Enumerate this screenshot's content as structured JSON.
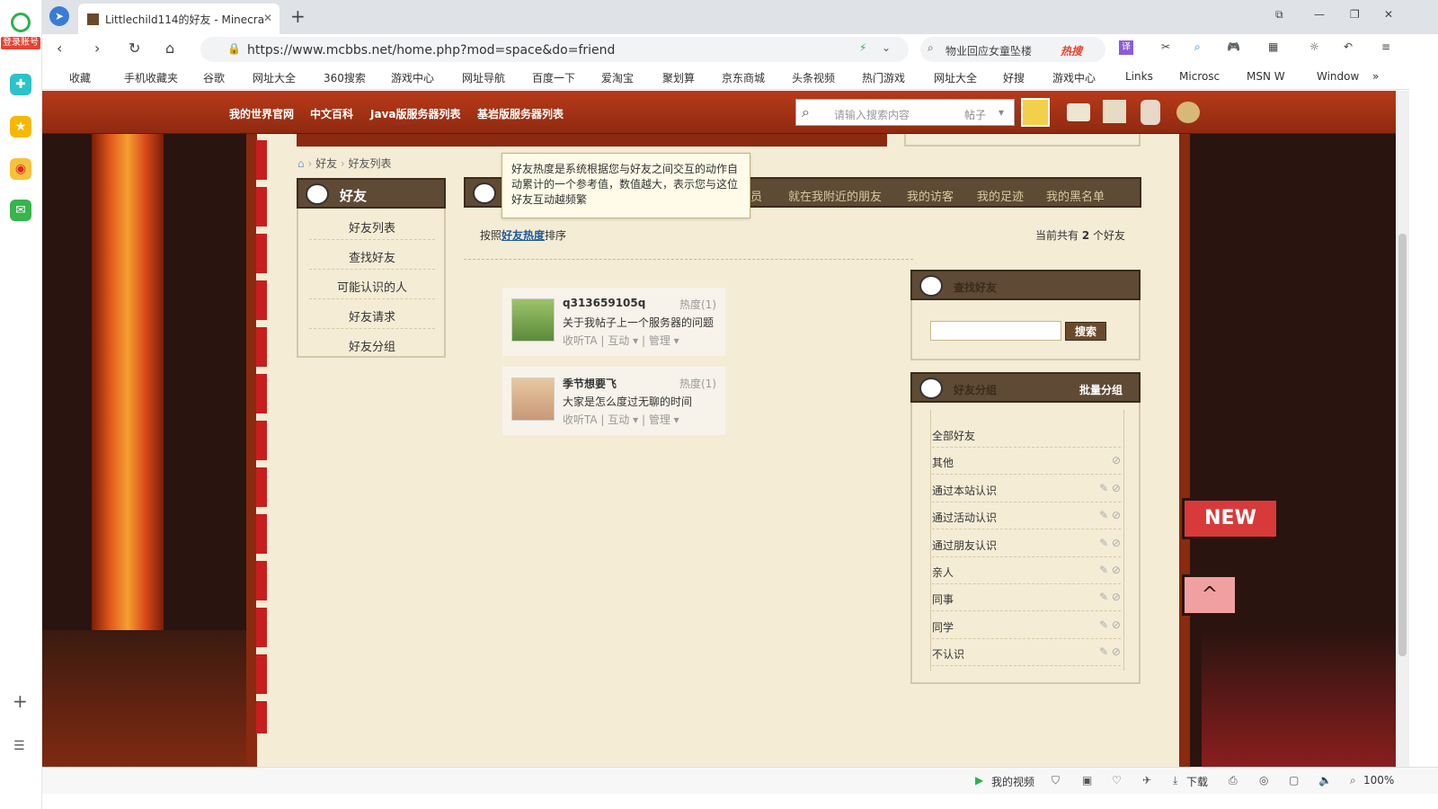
{
  "browser": {
    "tab_title": "Littlechild114的好友 - Minecra",
    "new_tab": "+",
    "url": "https://www.mcbbs.net/home.php?mod=space&do=friend",
    "search_hint": "物业回应女童坠楼",
    "hot_search": "热搜",
    "login_label": "登录账号",
    "window_buttons": {
      "min": "—",
      "max": "❐",
      "close": "✕"
    }
  },
  "bookmarks": [
    "收藏",
    "手机收藏夹",
    "谷歌",
    "网址大全",
    "360搜索",
    "游戏中心",
    "网址导航",
    "百度一下",
    "爱淘宝",
    "聚划算",
    "京东商城",
    "头条视频",
    "热门游戏",
    "网址大全",
    "好搜",
    "游戏中心",
    "Links",
    "Microsc",
    "MSN W",
    "Window",
    "»"
  ],
  "site": {
    "nav": [
      "我的世界官网",
      "中文百科",
      "Java版服务器列表",
      "基岩版服务器列表"
    ],
    "search_placeholder": "请输入搜索内容",
    "search_type": "帖子"
  },
  "breadcrumb": [
    "好友",
    "好友列表"
  ],
  "sidebar": {
    "title": "好友",
    "items": [
      "好友列表",
      "查找好友",
      "可能认识的人",
      "好友请求",
      "好友分组"
    ]
  },
  "tabs": [
    "员",
    "就在我附近的朋友",
    "我的访客",
    "我的足迹",
    "我的黑名单"
  ],
  "tooltip": "好友热度是系统根据您与好友之间交互的动作自动累计的一个参考值，数值越大，表示您与这位好友互动越频繁",
  "sort": {
    "prefix": "按照",
    "key": "好友热度",
    "suffix": "排序"
  },
  "count": {
    "prefix": "当前共有",
    "num": "2",
    "suffix": "个好友"
  },
  "friends": [
    {
      "name": "q313659105q",
      "heat": "热度(1)",
      "note": "关于我帖子上一个服务器的问题",
      "follow": "收听TA",
      "interact": "互动",
      "manage": "管理"
    },
    {
      "name": "季节想要飞",
      "heat": "热度(1)",
      "note": "大家是怎么度过无聊的时间",
      "follow": "收听TA",
      "interact": "互动",
      "manage": "管理"
    }
  ],
  "find_panel": {
    "title": "查找好友",
    "button": "搜索"
  },
  "groups_panel": {
    "title": "好友分组",
    "batch": "批量分组",
    "groups": [
      "全部好友",
      "其他",
      "通过本站认识",
      "通过活动认识",
      "通过朋友认识",
      "亲人",
      "同事",
      "同学",
      "不认识"
    ]
  },
  "statusbar": {
    "video": "我的视频",
    "download": "下载",
    "zoom": "100%"
  },
  "colors": {
    "accent": "#1a5a9e",
    "header": "#a83418",
    "panel": "#5e4a35"
  }
}
